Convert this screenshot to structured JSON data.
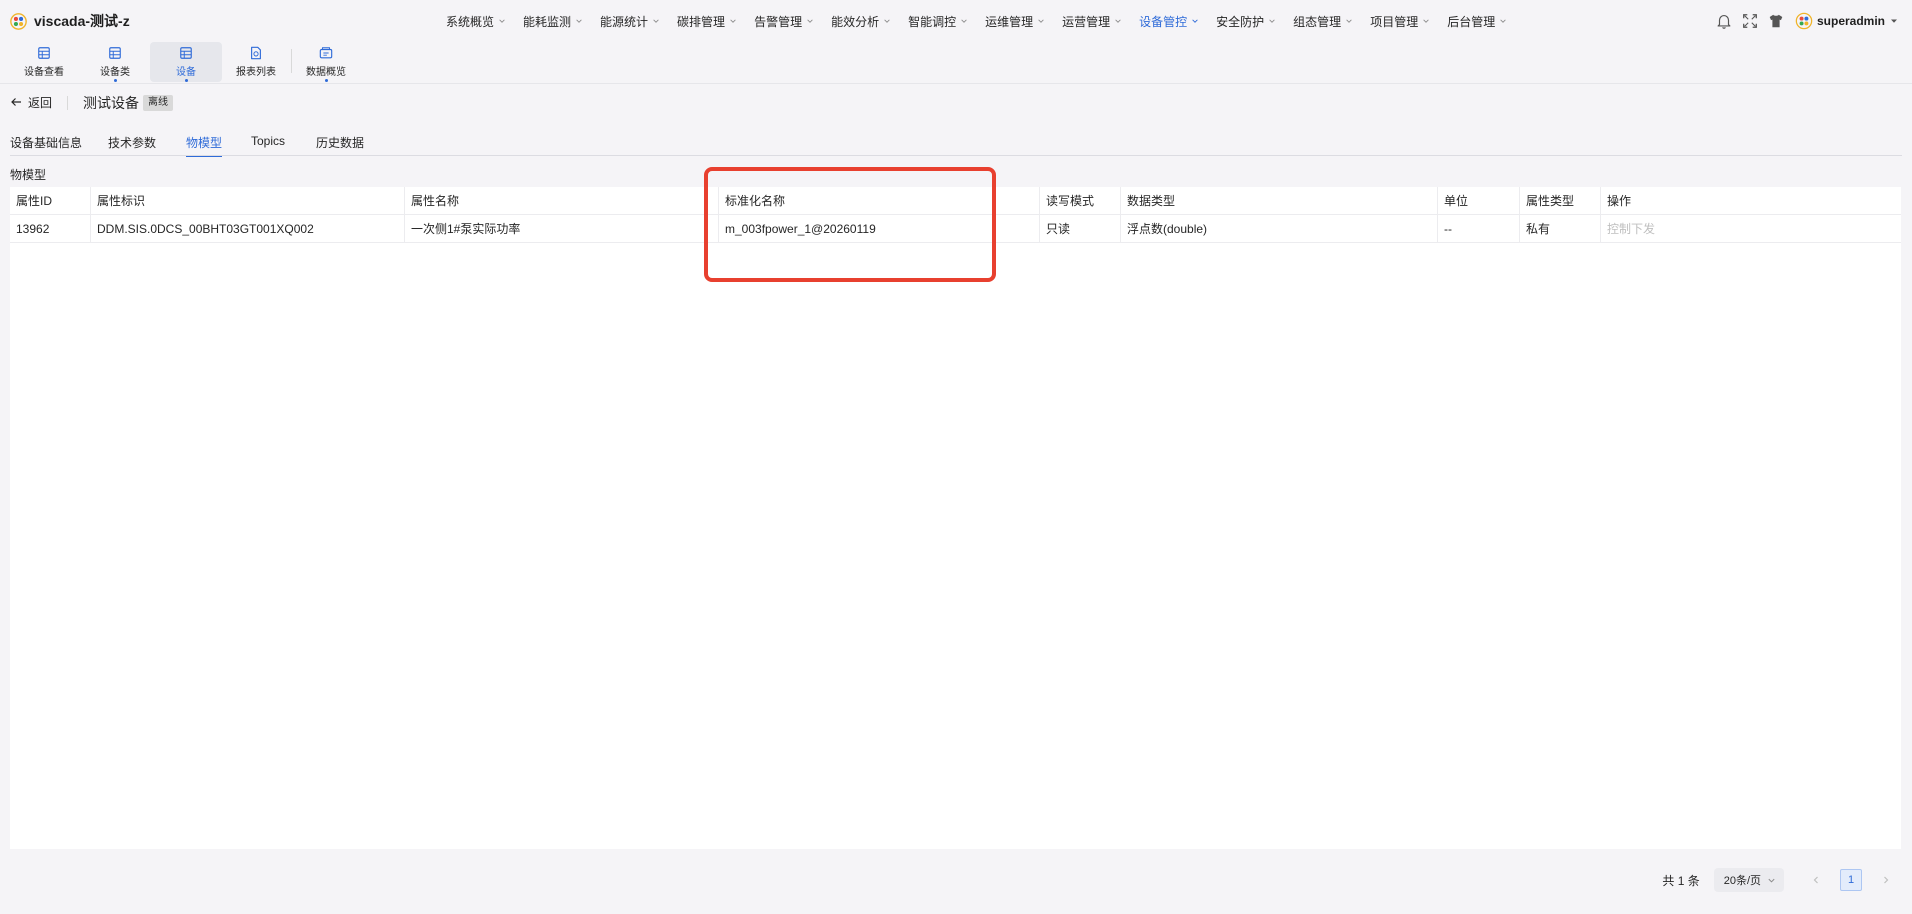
{
  "app": {
    "title": "viscada-测试-z"
  },
  "nav": {
    "items": [
      {
        "label": "系统概览"
      },
      {
        "label": "能耗监测"
      },
      {
        "label": "能源统计"
      },
      {
        "label": "碳排管理"
      },
      {
        "label": "告警管理"
      },
      {
        "label": "能效分析"
      },
      {
        "label": "智能调控"
      },
      {
        "label": "运维管理"
      },
      {
        "label": "运营管理"
      },
      {
        "label": "设备管控",
        "active": true
      },
      {
        "label": "安全防护"
      },
      {
        "label": "组态管理"
      },
      {
        "label": "项目管理"
      },
      {
        "label": "后台管理"
      }
    ]
  },
  "user": {
    "name": "superadmin"
  },
  "toolbar": {
    "items": [
      {
        "label": "设备查看",
        "icon": "device-view-icon"
      },
      {
        "label": "设备类",
        "icon": "device-class-icon"
      },
      {
        "label": "设备",
        "icon": "device-icon",
        "selected": true
      },
      {
        "label": "报表列表",
        "icon": "report-list-icon"
      },
      {
        "label": "数据概览",
        "icon": "data-overview-icon"
      }
    ]
  },
  "header": {
    "back_label": "返回",
    "title": "测试设备",
    "status": "离线"
  },
  "tabs": [
    {
      "label": "设备基础信息"
    },
    {
      "label": "技术参数"
    },
    {
      "label": "物模型",
      "active": true
    },
    {
      "label": "Topics"
    },
    {
      "label": "历史数据"
    }
  ],
  "section": {
    "title": "物模型"
  },
  "table": {
    "columns": [
      "属性ID",
      "属性标识",
      "属性名称",
      "标准化名称",
      "读写模式",
      "数据类型",
      "单位",
      "属性类型",
      "操作"
    ],
    "rows": [
      {
        "id": "13962",
        "identifier": "DDM.SIS.0DCS_00BHT03GT001XQ002",
        "name": "一次侧1#泵实际功率",
        "std_name": "m_003fpower_1@20260119",
        "rw_mode": "只读",
        "data_type": "浮点数(double)",
        "unit": "--",
        "attr_type": "私有",
        "action": "控制下发"
      }
    ]
  },
  "pagination": {
    "total": "共 1 条",
    "page_size": "20条/页",
    "current_page": "1"
  },
  "colors": {
    "accent": "#2f6bd8",
    "highlight": "#e8402f",
    "background": "#f5f4f7"
  }
}
